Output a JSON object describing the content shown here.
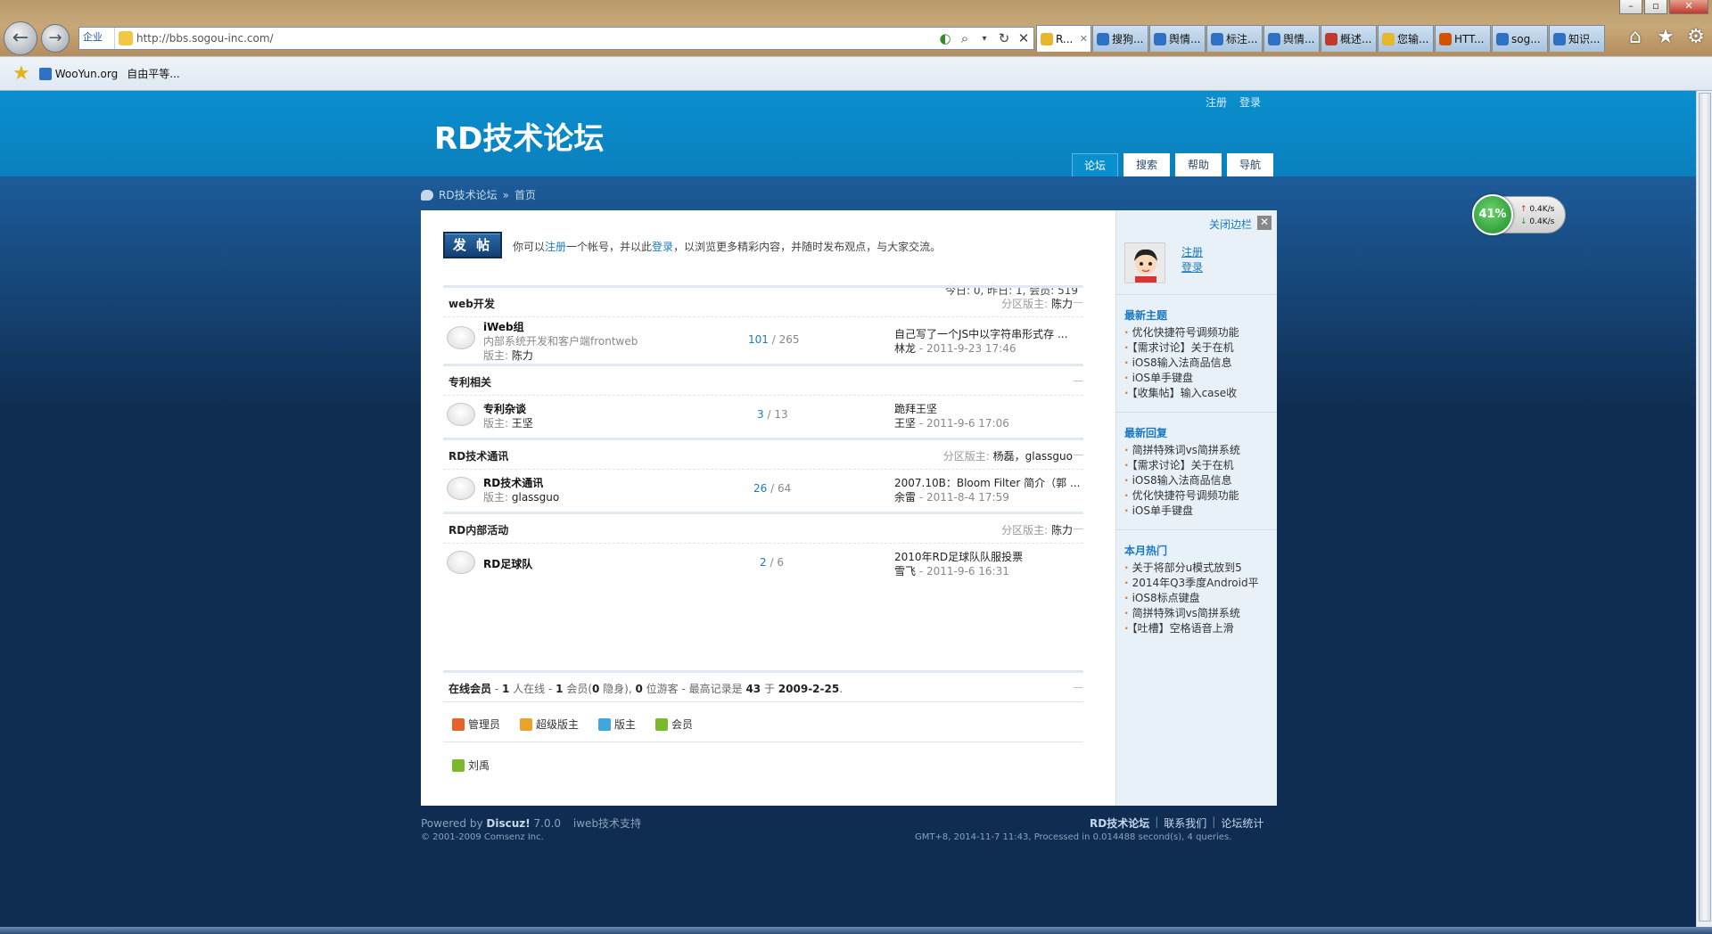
{
  "browser": {
    "address_zone": "企业",
    "url": "http://bbs.sogou-inc.com/",
    "tabs": [
      {
        "label": "R...",
        "active": true,
        "color": "#e8b52b"
      },
      {
        "label": "搜狗...",
        "color": "#2f72c4"
      },
      {
        "label": "舆情...",
        "color": "#2f72c4"
      },
      {
        "label": "标注...",
        "color": "#2f72c4"
      },
      {
        "label": "舆情...",
        "color": "#2f72c4"
      },
      {
        "label": "概述...",
        "color": "#c0392b"
      },
      {
        "label": "您输...",
        "color": "#e8b52b"
      },
      {
        "label": "HTT...",
        "color": "#d35400"
      },
      {
        "label": "sog...",
        "color": "#2f72c4"
      },
      {
        "label": "知识...",
        "color": "#2f72c4"
      }
    ],
    "favorites": [
      "WooYun.org",
      "自由平等..."
    ]
  },
  "site": {
    "title": "RD技术论坛",
    "top_links": [
      "注册",
      "登录"
    ],
    "nav_tabs": [
      "论坛",
      "搜索",
      "帮助",
      "导航"
    ],
    "breadcrumb": {
      "home": "RD技术论坛",
      "sep": "»",
      "current": "首页"
    }
  },
  "main": {
    "post_button": "发 帖",
    "welcome": {
      "pre": "你可以",
      "register": "注册",
      "mid": "一个帐号，并以此",
      "login": "登录",
      "post": "，以浏览更多精彩内容，并随时发布观点，与大家交流。"
    },
    "stats": "今日: 0, 昨日: 1, 会员: 519",
    "sections": [
      {
        "title": "web开发",
        "mods_label": "分区版主:",
        "mods": "陈力",
        "forums": [
          {
            "name": "iWeb组",
            "desc": "内部系统开发和客户端frontweb",
            "mod_label": "版主:",
            "mod": "陈力",
            "threads": "101",
            "posts": "265",
            "last_title": "自己写了一个JS中以字符串形式存 ...",
            "last_user": "林龙",
            "last_time": "- 2011-9-23 17:46"
          }
        ]
      },
      {
        "title": "专利相关",
        "mods_label": "",
        "mods": "",
        "forums": [
          {
            "name": "专利杂谈",
            "desc": "",
            "mod_label": "版主:",
            "mod": "王坚",
            "threads": "3",
            "posts": "13",
            "last_title": "跪拜王坚",
            "last_user": "王坚",
            "last_time": "- 2011-9-6 17:06"
          }
        ]
      },
      {
        "title": "RD技术通讯",
        "mods_label": "分区版主:",
        "mods": "杨磊，glassguo",
        "forums": [
          {
            "name": "RD技术通讯",
            "desc": "",
            "mod_label": "版主:",
            "mod": "glassguo",
            "threads": "26",
            "posts": "64",
            "last_title": "2007.10B：Bloom Filter 简介（郭 ...",
            "last_user": "余雷",
            "last_time": "- 2011-8-4 17:59"
          }
        ]
      },
      {
        "title": "RD内部活动",
        "mods_label": "分区版主:",
        "mods": "陈力",
        "forums": [
          {
            "name": "RD足球队",
            "desc": "",
            "mod_label": "",
            "mod": "",
            "threads": "2",
            "posts": "6",
            "last_title": "2010年RD足球队队服投票",
            "last_user": "雪飞",
            "last_time": "- 2011-9-6 16:31"
          }
        ]
      }
    ],
    "online": {
      "label": "在线会员",
      "total": "1",
      "t1": " 人在线 - ",
      "members": "1",
      "t2": " 会员(",
      "hidden": "0",
      "t3": " 隐身), ",
      "guests": "0",
      "t4": " 位游客 - 最高记录是 ",
      "record": "43",
      "t5": " 于 ",
      "record_date": "2009-2-25",
      "t6": "."
    },
    "legend": [
      {
        "label": "管理员",
        "color": "#e5622b"
      },
      {
        "label": "超级版主",
        "color": "#e8a32b"
      },
      {
        "label": "版主",
        "color": "#3fa7e0"
      },
      {
        "label": "会员",
        "color": "#7ab82c"
      }
    ],
    "online_user": "刘禹"
  },
  "sidebar": {
    "close_label": "关闭边栏",
    "close_x": "✕",
    "register": "注册",
    "login": "登录",
    "blocks": [
      {
        "title": "最新主题",
        "items": [
          "优化快捷符号调频功能",
          "【需求讨论】关于在机",
          "iOS8输入法商品信息",
          "iOS单手键盘",
          "【收集帖】输入case收"
        ]
      },
      {
        "title": "最新回复",
        "items": [
          "简拼特殊词vs简拼系统",
          "【需求讨论】关于在机",
          "iOS8输入法商品信息",
          "优化快捷符号调频功能",
          "iOS单手键盘"
        ]
      },
      {
        "title": "本月热门",
        "items": [
          "关于将部分u模式放到5",
          "2014年Q3季度Android平",
          "iOS8标点键盘",
          "简拼特殊词vs简拼系统",
          "【吐槽】空格语音上滑"
        ]
      }
    ]
  },
  "footer": {
    "powered_pre": "Powered by ",
    "powered_name": "Discuz!",
    "powered_ver": " 7.0.0",
    "support": "iweb技术支持",
    "copyright": "© 2001-2009 Comsenz Inc.",
    "right_title": "RD技术论坛",
    "right_links": [
      "联系我们",
      "论坛统计"
    ],
    "process": "GMT+8, 2014-11-7 11:43, Processed in 0.014488 second(s), 4 queries."
  },
  "net_widget": {
    "percent": "41%",
    "up": "0.4K/s",
    "down": "0.4K/s"
  }
}
